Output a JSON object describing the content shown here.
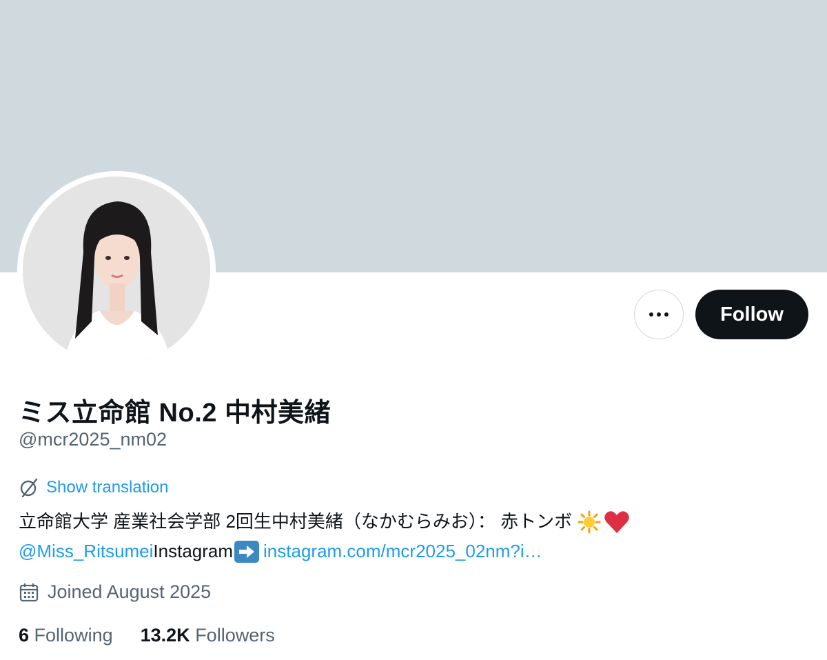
{
  "profile": {
    "display_name": "ミス立命館 No.2 中村美緒",
    "handle": "@mcr2025_nm02",
    "avatar_icon": "profile-photo",
    "more_icon": "more-horizontal-icon",
    "follow_label": "Follow"
  },
  "translation": {
    "icon": "translate-icon",
    "label": "Show translation"
  },
  "bio": {
    "line1_text": "立命館大学 産業社会学部 2回生中村美緒（なかむらみお）： 赤トンボ",
    "line1_emojis": [
      "sun-emoji",
      "heart-emoji"
    ],
    "mention": "@Miss_Ritsumei",
    "instagram_label": " Instagram",
    "arrow_icon": "right-arrow-emoji",
    "instagram_link": "instagram.com/mcr2025_02nm?i…"
  },
  "joined": {
    "icon": "calendar-icon",
    "text": "Joined August 2025"
  },
  "stats": {
    "following_count": "6",
    "following_label": "Following",
    "followers_count": "13.2K",
    "followers_label": "Followers"
  },
  "colors": {
    "banner": "#cfd9de",
    "accent": "#1d9bf0",
    "secondary_text": "#536471",
    "primary_text": "#0f1419"
  }
}
